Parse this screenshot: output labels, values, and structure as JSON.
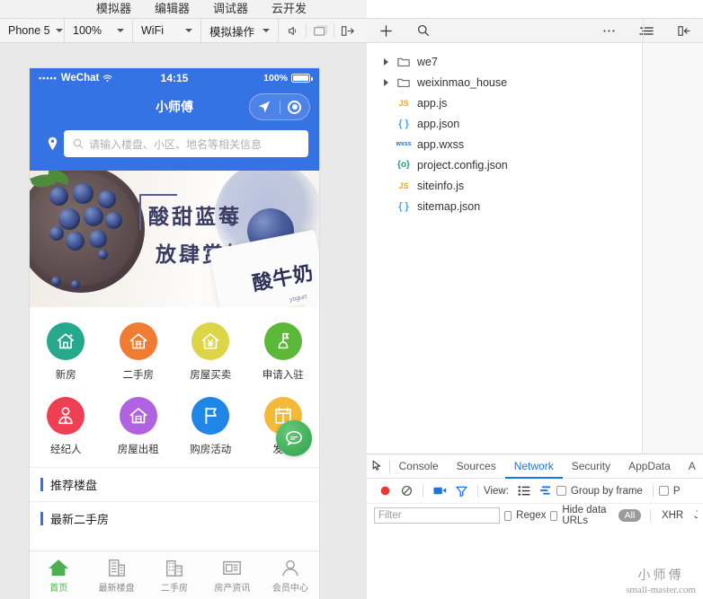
{
  "topmenu": {
    "items": [
      {
        "label": "模拟器"
      },
      {
        "label": "编辑器"
      },
      {
        "label": "调试器"
      },
      {
        "label": "云开发"
      }
    ]
  },
  "sim_toolbar": {
    "device": "Phone 5",
    "zoom": "100%",
    "network": "WiFi",
    "actions": "模拟操作",
    "icons": [
      "sound-icon",
      "window-icon",
      "panel-toggle-icon"
    ]
  },
  "phone": {
    "statusbar": {
      "carrier": "WeChat",
      "signal_dots": "•••••",
      "time": "14:15",
      "battery": "100%"
    },
    "navbar": {
      "title": "小师傅"
    },
    "search": {
      "placeholder": "请输入楼盘、小区、地名等相关信息"
    },
    "banner": {
      "line1": "酸甜蓝莓",
      "line2": "放肆赏鲜",
      "pack_text": "酸牛奶",
      "pack_sub": "yogurt"
    },
    "grid": [
      {
        "label": "新房",
        "icon": "new-house-icon",
        "color": "#25a88b"
      },
      {
        "label": "二手房",
        "icon": "second-hand-icon",
        "color": "#f07c33"
      },
      {
        "label": "房屋买卖",
        "icon": "house-trade-icon",
        "color": "#ddd447"
      },
      {
        "label": "申请入驻",
        "icon": "apply-join-icon",
        "color": "#5cb839"
      },
      {
        "label": "经纪人",
        "icon": "agent-icon",
        "color": "#ef3f52"
      },
      {
        "label": "房屋出租",
        "icon": "house-rent-icon",
        "color": "#b062e0"
      },
      {
        "label": "购房活动",
        "icon": "buy-activity-icon",
        "color": "#1f86e8"
      },
      {
        "label": "发布",
        "icon": "publish-icon",
        "color": "#f5b93a"
      }
    ],
    "chat_bubble": "chat-bubble-icon",
    "sections": [
      {
        "title": "推荐楼盘"
      },
      {
        "title": "最新二手房"
      }
    ],
    "tabbar": [
      {
        "label": "首页",
        "icon": "home-icon",
        "active": true
      },
      {
        "label": "最新楼盘",
        "icon": "building-icon",
        "active": false
      },
      {
        "label": "二手房",
        "icon": "apartment-icon",
        "active": false
      },
      {
        "label": "房产资讯",
        "icon": "news-icon",
        "active": false
      },
      {
        "label": "会员中心",
        "icon": "user-icon",
        "active": false
      }
    ]
  },
  "editor_toolbar": {
    "icons": [
      "add-icon",
      "search-icon",
      "more-icon",
      "outline-icon",
      "collapse-panel-icon"
    ]
  },
  "filetree": [
    {
      "name": "we7",
      "type": "folder",
      "expandable": true
    },
    {
      "name": "weixinmao_house",
      "type": "folder",
      "expandable": true
    },
    {
      "name": "app.js",
      "type": "js",
      "badge": "JS",
      "color": "#f5a623"
    },
    {
      "name": "app.json",
      "type": "json",
      "badge": "{ }",
      "color": "#4aa3f0"
    },
    {
      "name": "app.wxss",
      "type": "wxss",
      "badge": "wxss",
      "color": "#2a74c8"
    },
    {
      "name": "project.config.json",
      "type": "config",
      "badge": "{o}",
      "color": "#16a085"
    },
    {
      "name": "siteinfo.js",
      "type": "js",
      "badge": "JS",
      "color": "#f5a623"
    },
    {
      "name": "sitemap.json",
      "type": "json",
      "badge": "{ }",
      "color": "#4aa3f0"
    }
  ],
  "devtools": {
    "inspect_icon": "inspect-element-icon",
    "tabs": [
      {
        "label": "Console",
        "active": false
      },
      {
        "label": "Sources",
        "active": false
      },
      {
        "label": "Network",
        "active": true
      },
      {
        "label": "Security",
        "active": false
      },
      {
        "label": "AppData",
        "active": false
      },
      {
        "label": "A",
        "active": false
      }
    ],
    "network_toolbar": {
      "record_icon": "record-icon",
      "clear_icon": "clear-icon",
      "camera_icon": "camera-icon",
      "filter_icon": "filter-icon",
      "view_label": "View:",
      "view_list_icon": "view-list-icon",
      "view_waterfall_icon": "view-waterfall-icon",
      "group_by_frame": "Group by frame",
      "preserve_log": "P"
    },
    "filter_row": {
      "filter_placeholder": "Filter",
      "filter_value": "",
      "regex_label": "Regex",
      "hide_data_urls_label": "Hide data URLs",
      "type_all": "All",
      "type_xhr": "XHR",
      "type_js": "J"
    }
  },
  "watermark": {
    "cn": "小师傅",
    "en": "small-master.com"
  },
  "colors": {
    "wechat_blue": "#3572e3",
    "devtools_accent": "#1a73e8",
    "record_red": "#e53935",
    "tab_active_green": "#4caf50"
  }
}
